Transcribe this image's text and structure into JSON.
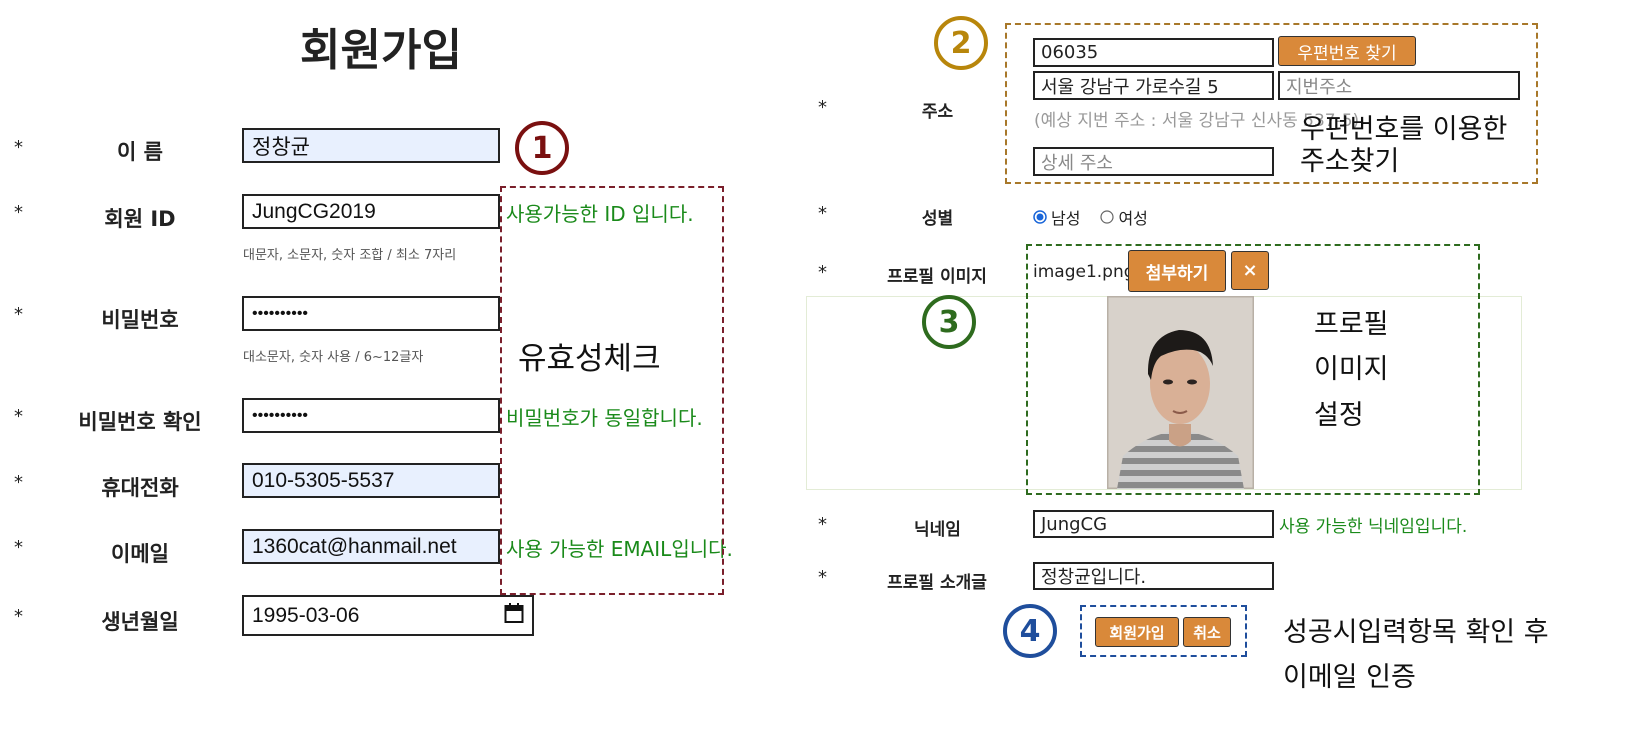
{
  "left": {
    "title": "회원가입",
    "fields": [
      {
        "label": "이 름",
        "value": "정창균"
      },
      {
        "label": "회원 ID",
        "value": "JungCG2019",
        "hint": "대문자, 소문자, 숫자 조합 / 최소 7자리",
        "status": "사용가능한 ID 입니다."
      },
      {
        "label": "비밀번호",
        "value": "••••••••••",
        "hint": "대소문자, 숫자 사용 / 6~12글자"
      },
      {
        "label": "비밀번호 확인",
        "value": "••••••••••",
        "status": "비밀번호가 동일합니다."
      },
      {
        "label": "휴대전화",
        "value": "010-5305-5537"
      },
      {
        "label": "이메일",
        "value": "1360cat@hanmail.net",
        "status": "사용 가능한 EMAIL입니다."
      },
      {
        "label": "생년월일",
        "value": "1995-03-06"
      }
    ],
    "required_mark": "*",
    "validity_note": "유효성체크",
    "marker": "1"
  },
  "right": {
    "address": {
      "label": "주소",
      "postcode": "06035",
      "find_button": "우편번호 찾기",
      "road_address": "서울 강남구 가로수길 5",
      "jibun_placeholder": "지번주소",
      "expected_jibun": "(예상 지번 주소 : 서울 강남구 신사동 537-5)",
      "detail_placeholder": "상세 주소",
      "note_line1": "우편번호를 이용한",
      "note_line2": "주소찾기",
      "marker": "2"
    },
    "gender": {
      "label": "성별",
      "options": [
        "남성",
        "여성"
      ],
      "selected": "남성"
    },
    "profile_image": {
      "label": "프로필 이미지",
      "filename": "image1.png",
      "attach_button": "첨부하기",
      "remove_button": "×",
      "note_line1": "프로필",
      "note_line2": "이미지",
      "note_line3": "설정",
      "marker": "3"
    },
    "nickname": {
      "label": "닉네임",
      "value": "JungCG",
      "status": "사용 가능한 닉네임입니다."
    },
    "intro": {
      "label": "프로필 소개글",
      "value": "정창균입니다."
    },
    "actions": {
      "signup": "회원가입",
      "cancel": "취소",
      "marker": "4",
      "note_line1": "성공시입력항목 확인  후",
      "note_line2": "이메일 인증"
    },
    "required_mark": "*"
  },
  "colors": {
    "accent_orange": "#d9893a",
    "success_green": "#1a8a1a",
    "marker1": "#7a1010",
    "marker2": "#b8860b",
    "marker3": "#2e6b1e",
    "marker4": "#1f4e9c"
  }
}
